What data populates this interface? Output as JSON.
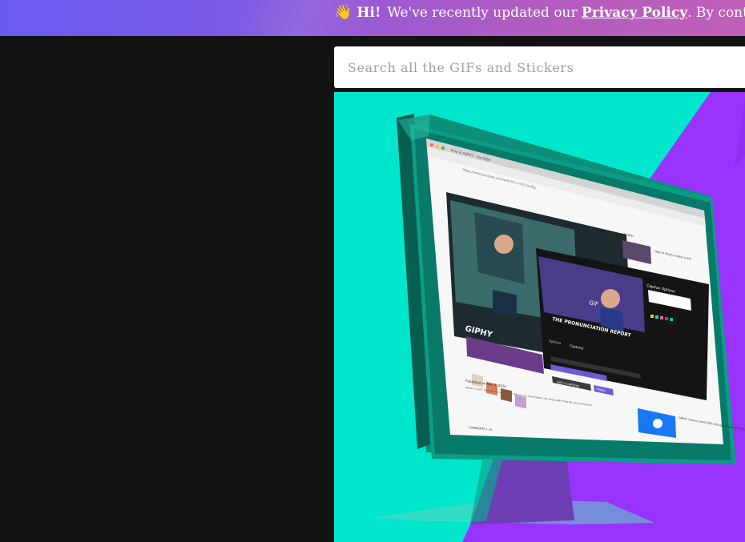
{
  "banner": {
    "emoji": "👋",
    "greeting": "Hi!",
    "text_before": "We've recently updated our",
    "link": "Privacy Policy",
    "text_after": ". By continuing to"
  },
  "search": {
    "placeholder": "Search all the GIFs and Stickers"
  },
  "hero": {
    "browser_tab": "This is GIPHY - YouTube",
    "browser_url": "https://www.youtube.com/watch?v=iI7E-Yzu2fg",
    "video_title": "GIPHY",
    "video_logo": "GIPHY",
    "up_next": "Up Next",
    "autoplay": "Autoplay",
    "caption_options": "Caption Options",
    "caption_text": "GIF",
    "pronunciation": "THE PRONUNCIATION REPORT",
    "tab_options": "Options",
    "tab_captions": "Captions",
    "add_caption": "ADD A CAPTION",
    "publish": "FINISH",
    "published": "Published on Nov 3, 2014",
    "description": "What's a GIF? How do you use them? Where can I find them? Are they safe? How do you pronounce",
    "comments": "COMMENTS • 15",
    "sidebar_video_1": "How to Easily Create a GIF",
    "sidebar_video_2": "GIPHY: How to send GIFs through Facebook Messenger",
    "colors": {
      "teal": "#00e6cc",
      "purple": "#9933ff",
      "monitor_teal": "#0b9a84",
      "monitor_dark": "#087a69"
    }
  }
}
